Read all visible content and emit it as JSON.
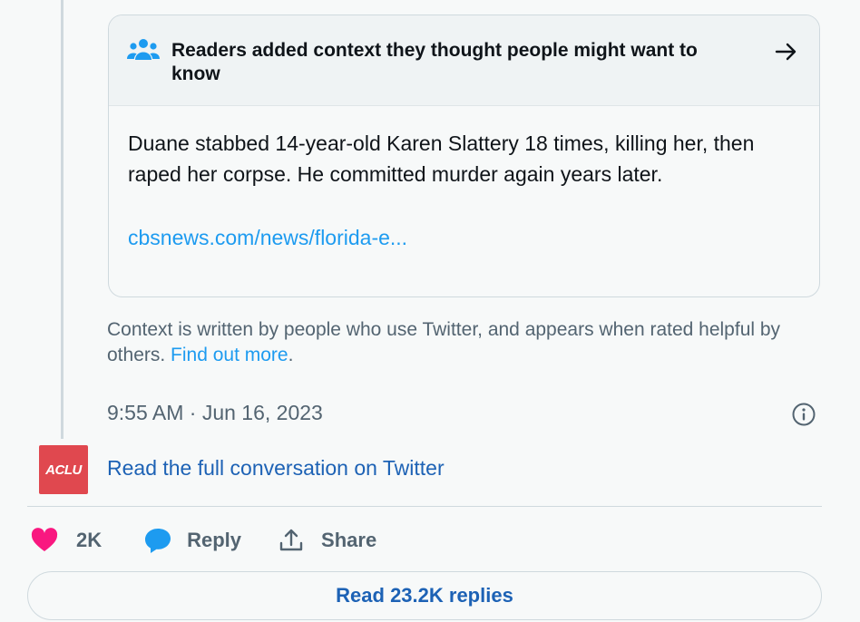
{
  "note": {
    "title": "Readers added context they thought people might want to know",
    "body": "Duane stabbed 14-year-old Karen Slattery 18 times, killing her, then raped her corpse. He committed murder again years later.",
    "link_text": "cbsnews.com/news/florida-e..."
  },
  "context": {
    "text": "Context is written by people who use Twitter, and appears when rated helpful by others.",
    "link": "Find out more",
    "suffix": "."
  },
  "tweet": {
    "timestamp": "9:55 AM · Jun 16, 2023",
    "avatar_text": "ACLU",
    "full_conversation": "Read the full conversation on Twitter"
  },
  "actions": {
    "like_count": "2K",
    "reply_label": "Reply",
    "share_label": "Share"
  },
  "replies_button": "Read 23.2K replies",
  "colors": {
    "accent": "#1d9bf0",
    "link_dark": "#1d62b5",
    "like": "#f91880",
    "avatar_bg": "#e0484f",
    "muted": "#536471"
  },
  "icons": [
    "people-icon",
    "arrow-right-icon",
    "info-icon",
    "heart-icon",
    "reply-bubble-icon",
    "share-icon"
  ]
}
